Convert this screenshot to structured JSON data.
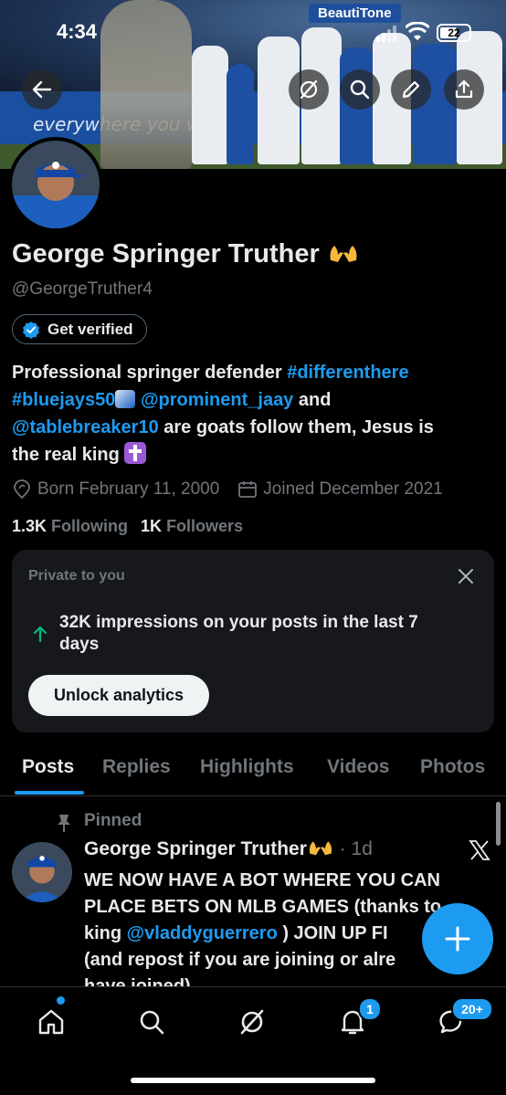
{
  "status_bar": {
    "time": "4:34",
    "battery": "22"
  },
  "profile": {
    "display_name": "George Springer Truther",
    "handle": "@GeorgeTruther4",
    "verify_label": "Get verified",
    "bio": {
      "line1_text": "Professional springer defender ",
      "hashtag1": "#differenthere",
      "hashtag2": "#bluejays50",
      "mention1": "@prominent_jaay",
      "and": " and",
      "mention2": "@tablebreaker10",
      "line3_rest": " are goats follow them, Jesus is",
      "line4": "the real king"
    },
    "born": "Born February 11, 2000",
    "joined": "Joined December 2021",
    "following_count": "1.3K",
    "following_label": "Following",
    "followers_count": "1K",
    "followers_label": "Followers"
  },
  "private_card": {
    "title": "Private to you",
    "impressions": "32K impressions on your posts in the last 7 days",
    "unlock_label": "Unlock analytics"
  },
  "tabs": [
    {
      "label": "Posts",
      "active": true
    },
    {
      "label": "Replies"
    },
    {
      "label": "Highlights"
    },
    {
      "label": "Videos"
    },
    {
      "label": "Photos"
    }
  ],
  "post": {
    "pinned_label": "Pinned",
    "author": "George Springer Truther",
    "age": "· 1d",
    "text_line1": "WE NOW HAVE A BOT WHERE YOU CAN",
    "text_line2": "PLACE BETS ON MLB GAMES (thanks to",
    "text_line3_pre": "king ",
    "text_mention": "@vladdyguerrero",
    "text_line3_post": " ) JOIN UP FI",
    "text_line4": "(and repost if you are joining or alre",
    "text_line5": "have joined)"
  },
  "banner": {
    "sign_text": "BeautiTone",
    "ad_text": "everywhere you want"
  },
  "nav": {
    "notifications_badge": "1",
    "messages_badge": "20+"
  },
  "colors": {
    "accent": "#1d9bf0",
    "background": "#000000",
    "card": "#16181c",
    "muted": "#71767b",
    "up_arrow": "#00ba7c"
  },
  "icons": [
    "back-arrow-icon",
    "grok-icon",
    "search-icon",
    "edit-icon",
    "share-icon",
    "verified-badge-icon",
    "raised-hands-emoji",
    "blue-jays-emoji",
    "cross-emoji",
    "location-icon",
    "calendar-icon",
    "close-icon",
    "up-arrow-icon",
    "pin-icon",
    "x-logo-icon",
    "plus-icon",
    "home-icon",
    "bell-icon",
    "messages-icon"
  ]
}
